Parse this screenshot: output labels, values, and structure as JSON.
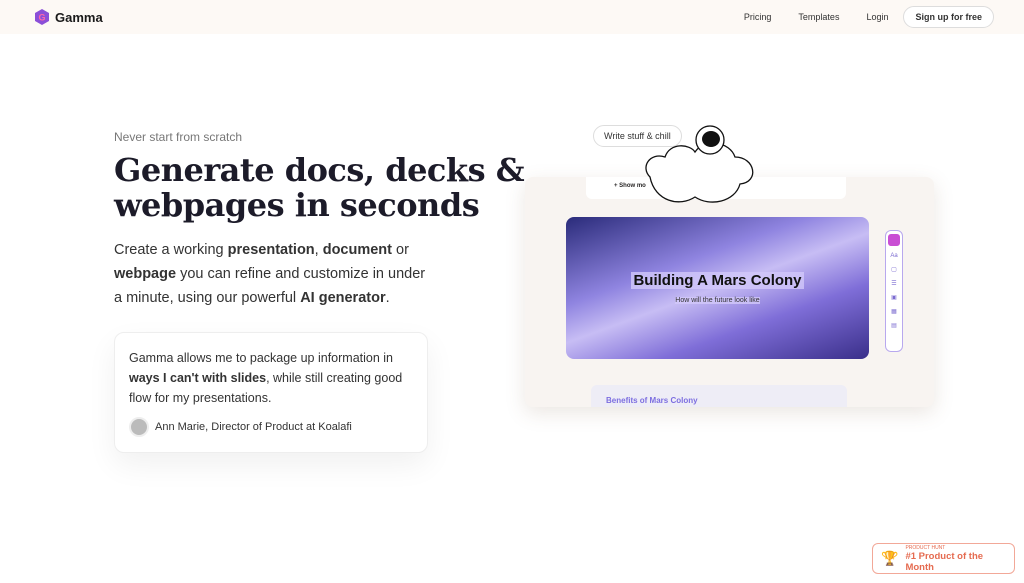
{
  "nav": {
    "brand": "Gamma",
    "links": [
      "Pricing",
      "Templates",
      "Login"
    ],
    "signup": "Sign up for free"
  },
  "hero": {
    "eyebrow": "Never start from scratch",
    "title_line1": "Generate docs, decks &",
    "title_line2": "webpages in seconds",
    "desc": [
      {
        "t": "Create a working ",
        "b": false
      },
      {
        "t": "presentation",
        "b": true
      },
      {
        "t": ", ",
        "b": false
      },
      {
        "t": "document",
        "b": true
      },
      {
        "t": " or ",
        "b": false
      },
      {
        "t": "webpage",
        "b": true
      },
      {
        "t": " you can refine and customize in under a minute, using our powerful ",
        "b": false
      },
      {
        "t": "AI generator",
        "b": true
      },
      {
        "t": ".",
        "b": false
      }
    ]
  },
  "testimonial": {
    "pre": "Gamma allows me to package up information in ",
    "bold": "ways I can't with slides",
    "post": ", while still creating good flow for my presentations.",
    "author": "Ann Marie, Director of Product at Koalafi"
  },
  "demo": {
    "pill": "Write stuff & chill",
    "show_more": "+ Show mo",
    "slide_title": "Building A Mars Colony",
    "slide_subtitle": "How will the future look like",
    "tool_text": "Aa",
    "next_card": "Benefits of Mars Colony"
  },
  "badge": {
    "label": "PRODUCT HUNT",
    "title": "#1 Product of the Month",
    "color": "#e56b50"
  }
}
